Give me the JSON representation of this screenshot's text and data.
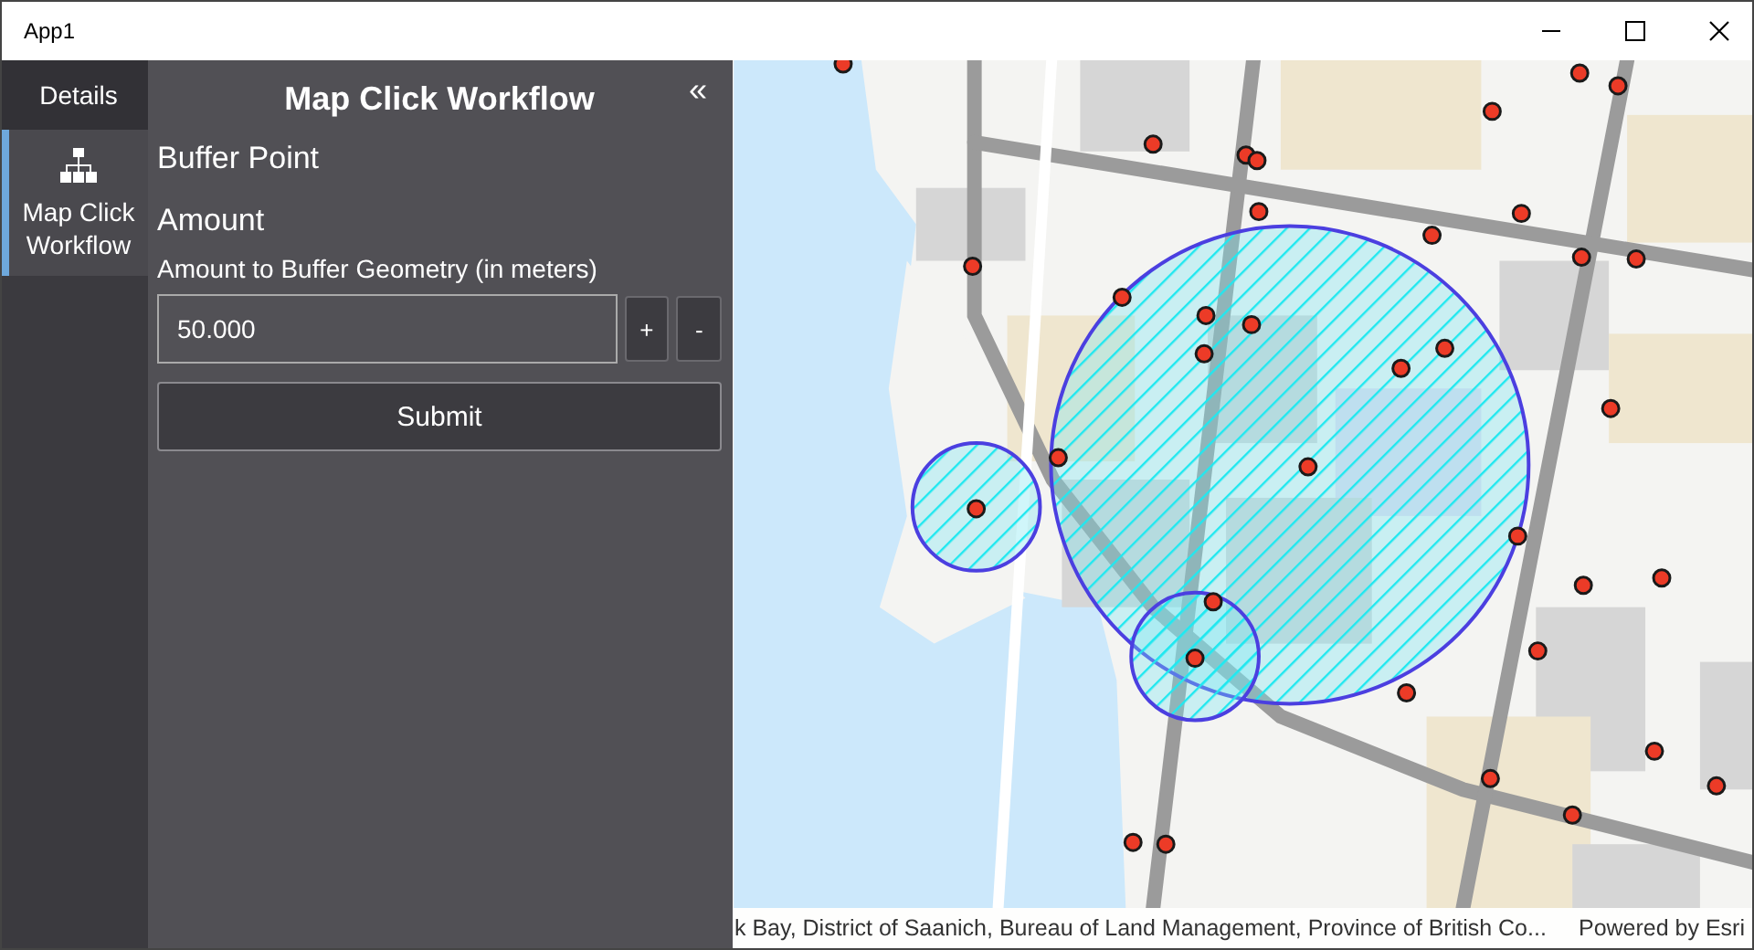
{
  "window": {
    "title": "App1"
  },
  "nav_tabs": [
    {
      "label": "Details",
      "kind": "text",
      "selected": false
    },
    {
      "label": "Map Click Workflow",
      "kind": "icon",
      "selected": true
    }
  ],
  "panel": {
    "title": "Map Click Workflow",
    "collapse_button": "«",
    "section": "Buffer Point",
    "subsection": "Amount",
    "field_label": "Amount to Buffer Geometry (in meters)",
    "field_value": "50.000",
    "increment_button": "+",
    "decrement_button": "-",
    "submit_button": "Submit"
  },
  "map": {
    "attribution": "k Bay, District of Saanich, Bureau of Land Management, Province of British Co...",
    "powered_by": "Powered by Esri"
  }
}
